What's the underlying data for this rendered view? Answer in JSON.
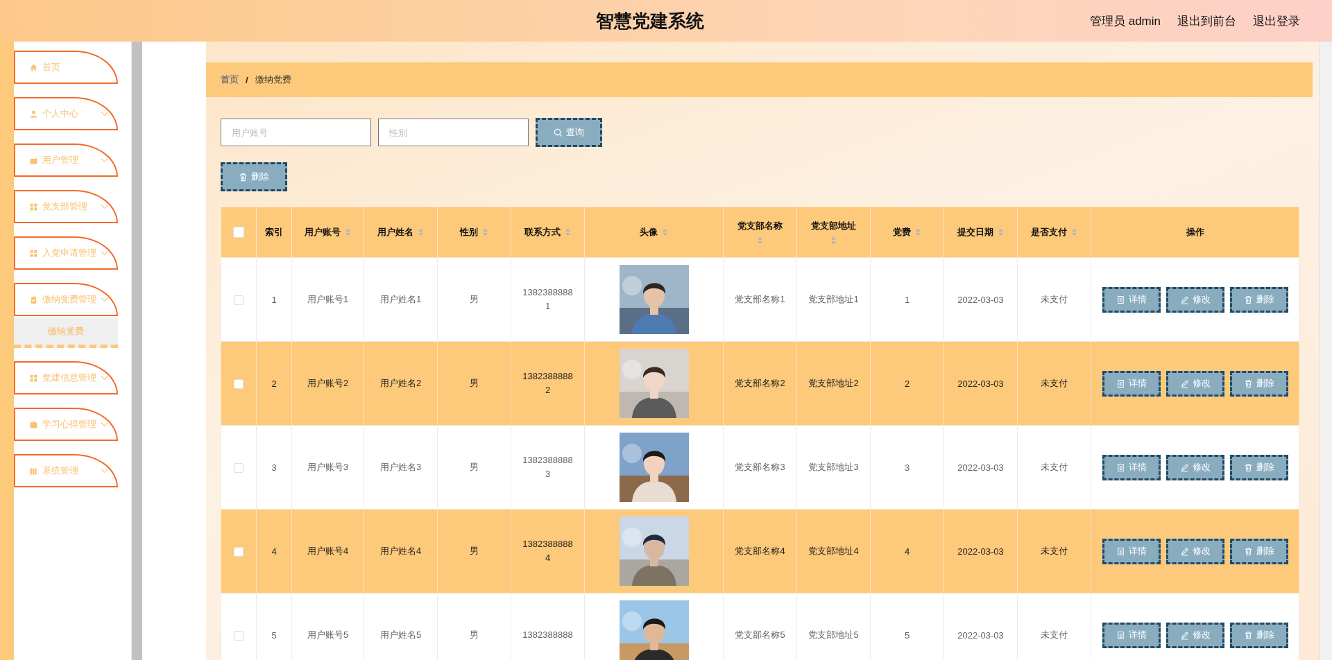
{
  "header": {
    "title": "智慧党建系统",
    "links": [
      "管理员 admin",
      "退出到前台",
      "退出登录"
    ]
  },
  "sidebar": {
    "items": [
      {
        "label": "首页",
        "expandable": false
      },
      {
        "label": "个人中心",
        "expandable": true,
        "expanded": false
      },
      {
        "label": "用户管理",
        "expandable": true,
        "expanded": false
      },
      {
        "label": "党支部管理",
        "expandable": true,
        "expanded": false
      },
      {
        "label": "入党申请管理",
        "expandable": true,
        "expanded": false
      },
      {
        "label": "缴纳党费管理",
        "expandable": true,
        "expanded": true,
        "children": [
          {
            "label": "缴纳党费",
            "selected": true
          }
        ]
      },
      {
        "label": "党建信息管理",
        "expandable": true,
        "expanded": false
      },
      {
        "label": "学习心得管理",
        "expandable": true,
        "expanded": false
      },
      {
        "label": "系统管理",
        "expandable": true,
        "expanded": false
      }
    ]
  },
  "breadcrumb": {
    "items": [
      "首页",
      "缴纳党费"
    ],
    "separator": "/"
  },
  "search": {
    "fields": [
      {
        "placeholder": "用户账号"
      },
      {
        "placeholder": "性别"
      }
    ],
    "button": "查询"
  },
  "delete_button": "删除",
  "table": {
    "select_all_checked": false,
    "columns": [
      {
        "label": "索引",
        "sortable": false
      },
      {
        "label": "用户账号",
        "sortable": true
      },
      {
        "label": "用户姓名",
        "sortable": true
      },
      {
        "label": "性别",
        "sortable": true
      },
      {
        "label": "联系方式",
        "sortable": true
      },
      {
        "label": "头像",
        "sortable": true
      },
      {
        "label": "党支部名称",
        "sortable": true
      },
      {
        "label": "党支部地址",
        "sortable": true
      },
      {
        "label": "党费",
        "sortable": true
      },
      {
        "label": "提交日期",
        "sortable": true
      },
      {
        "label": "是否支付",
        "sortable": true
      },
      {
        "label": "操作",
        "sortable": false
      }
    ],
    "rows": [
      {
        "checked": false,
        "index": "1",
        "account": "用户账号1",
        "name": "用户姓名1",
        "gender": "男",
        "phone": "13823888881",
        "branch_name": "党支部名称1",
        "branch_address": "党支部地址1",
        "fee": "1",
        "date": "2022-03-03",
        "paid": "未支付",
        "actions": [
          "详情",
          "修改",
          "删除"
        ]
      },
      {
        "checked": false,
        "index": "2",
        "account": "用户账号2",
        "name": "用户姓名2",
        "gender": "男",
        "phone": "13823888882",
        "branch_name": "党支部名称2",
        "branch_address": "党支部地址2",
        "fee": "2",
        "date": "2022-03-03",
        "paid": "未支付",
        "actions": [
          "详情",
          "修改",
          "删除"
        ]
      },
      {
        "checked": false,
        "index": "3",
        "account": "用户账号3",
        "name": "用户姓名3",
        "gender": "男",
        "phone": "13823888883",
        "branch_name": "党支部名称3",
        "branch_address": "党支部地址3",
        "fee": "3",
        "date": "2022-03-03",
        "paid": "未支付",
        "actions": [
          "详情",
          "修改",
          "删除"
        ]
      },
      {
        "checked": false,
        "index": "4",
        "account": "用户账号4",
        "name": "用户姓名4",
        "gender": "男",
        "phone": "13823888884",
        "branch_name": "党支部名称4",
        "branch_address": "党支部地址4",
        "fee": "4",
        "date": "2022-03-03",
        "paid": "未支付",
        "actions": [
          "详情",
          "修改",
          "删除"
        ]
      },
      {
        "checked": false,
        "index": "5",
        "account": "用户账号5",
        "name": "用户姓名5",
        "gender": "男",
        "phone": "1382388888",
        "branch_name": "党支部名称5",
        "branch_address": "党支部地址5",
        "fee": "5",
        "date": "2022-03-03",
        "paid": "未支付",
        "actions": [
          "详情",
          "修改",
          "删除"
        ]
      }
    ]
  }
}
